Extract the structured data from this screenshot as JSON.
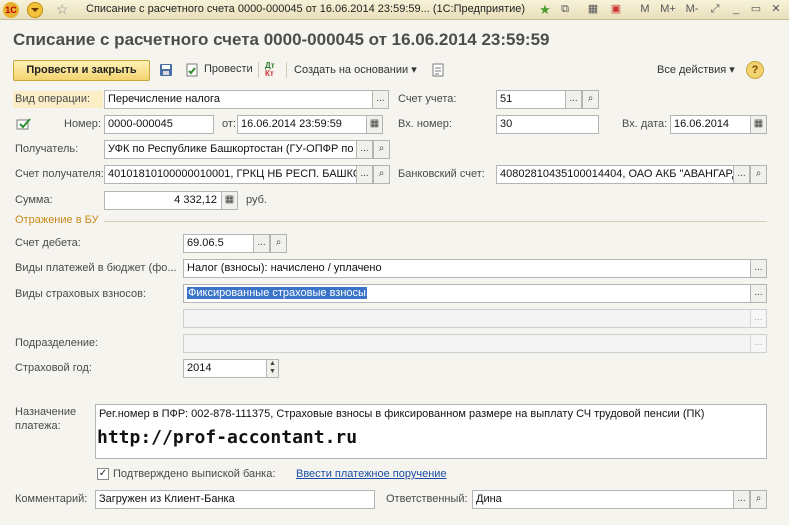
{
  "window": {
    "title": "Списание с расчетного счета 0000-000045 от 16.06.2014 23:59:59... (1С:Предприятие)",
    "app_badge": "1С",
    "buttons": {
      "m": "M",
      "m_plus": "M+",
      "m_minus": "M-"
    }
  },
  "document": {
    "title": "Списание с расчетного счета 0000-000045 от 16.06.2014 23:59:59"
  },
  "toolbar": {
    "post_and_close": "Провести и закрыть",
    "post": "Провести",
    "create_based_on": "Создать на основании",
    "all_actions": "Все действия",
    "help": "?"
  },
  "form": {
    "operation_type": {
      "label": "Вид операции:",
      "value": "Перечисление налога"
    },
    "account": {
      "label": "Счет учета:",
      "value": "51"
    },
    "number": {
      "label": "Номер:",
      "value": "0000-000045"
    },
    "date": {
      "label": "от:",
      "value": "16.06.2014 23:59:59"
    },
    "in_number": {
      "label": "Вх. номер:",
      "value": "30"
    },
    "in_date": {
      "label": "Вх. дата:",
      "value": "16.06.2014"
    },
    "recipient": {
      "label": "Получатель:",
      "value": "УФК по Республике Башкортостан (ГУ-ОПФР по"
    },
    "recipient_account": {
      "label": "Счет получателя:",
      "value": "40101810100000010001, ГРКЦ НБ РЕСП. БАШКОР"
    },
    "bank_account": {
      "label": "Банковский счет:",
      "value": "40802810435100014404, ОАО АКБ \"АВАНГАРД"
    },
    "amount": {
      "label": "Сумма:",
      "value": "4 332,12",
      "currency": "руб."
    }
  },
  "accounting": {
    "section_title": "Отражение в БУ",
    "debit_account": {
      "label": "Счет дебета:",
      "value": "69.06.5"
    },
    "budget_payment_types": {
      "label": "Виды платежей в бюджет (фо...",
      "value": "Налог (взносы): начислено / уплачено"
    },
    "insurance_types": {
      "label": "Виды страховых взносов:",
      "value": "Фиксированные страховые взносы"
    },
    "subdivision": {
      "label": "Подразделение:",
      "value": ""
    },
    "insurance_year": {
      "label": "Страховой год:",
      "value": "2014"
    }
  },
  "purpose": {
    "label_line1": "Назначение",
    "label_line2": "платежа:",
    "text": "Рег.номер в ПФР: 002-878-111375, Страховые взносы в фиксированном размере на выплату СЧ трудовой пенсии (ПК)",
    "watermark_url": "http://prof-accontant.ru"
  },
  "footer": {
    "confirmed_checkbox": {
      "label": "Подтверждено выпиской банка:",
      "checked": true
    },
    "enter_payment_link": "Ввести платежное поручение",
    "comment": {
      "label": "Комментарий:",
      "value": "Загружен из Клиент-Банка"
    },
    "responsible": {
      "label": "Ответственный:",
      "value": "Дина"
    }
  },
  "colors": {
    "accent": "#f3d36f",
    "title": "#4d4d4d",
    "section": "#c8891b",
    "link": "#1a4ea6",
    "highlight": "#fbeec7",
    "selection": "#3a74c9"
  }
}
